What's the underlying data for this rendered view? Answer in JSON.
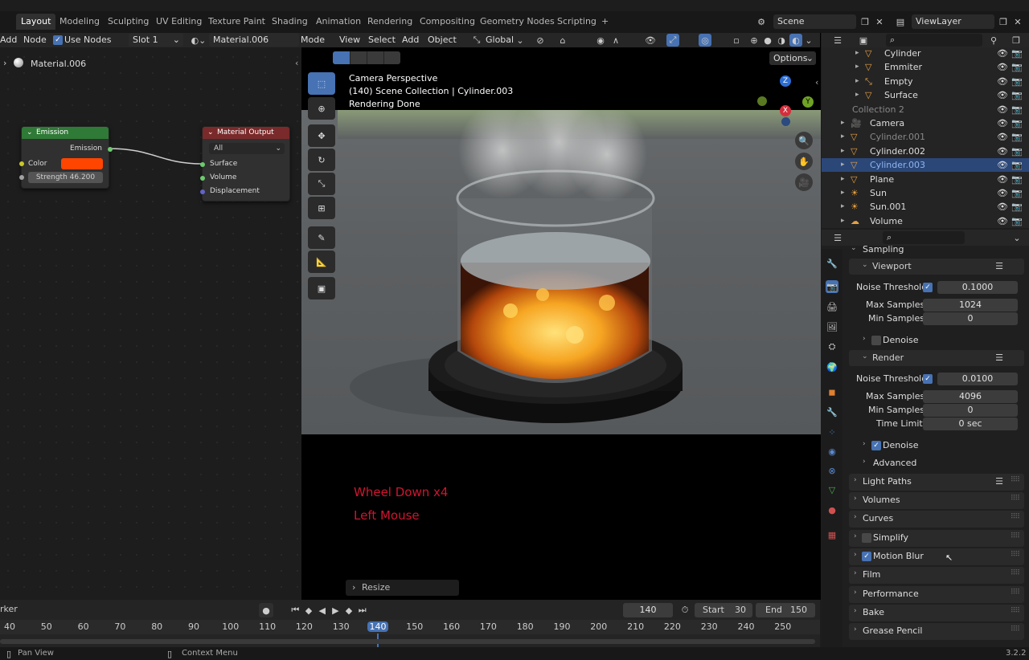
{
  "topbar": {
    "tabs": [
      "Layout",
      "Modeling",
      "Sculpting",
      "UV Editing",
      "Texture Paint",
      "Shading",
      "Animation",
      "Rendering",
      "Compositing",
      "Geometry Nodes",
      "Scripting"
    ],
    "add_tab": "+",
    "scene": "Scene",
    "view_layer": "ViewLayer"
  },
  "node_editor": {
    "menu_add": "Add",
    "menu_node": "Node",
    "use_nodes": "Use Nodes",
    "slot": "Slot 1",
    "material": "Material.006",
    "breadcrumb": "Material.006",
    "emission_node": {
      "title": "Emission",
      "output": "Emission",
      "color_label": "Color",
      "color": "#ff4500",
      "strength": "Strength  46.200"
    },
    "output_node": {
      "title": "Material Output",
      "target": "All",
      "surface": "Surface",
      "volume": "Volume",
      "displacement": "Displacement"
    }
  },
  "viewport": {
    "menu": [
      "Mode",
      "View",
      "Select",
      "Add",
      "Object"
    ],
    "orientation": "Global",
    "options": "Options",
    "overlay_lines": [
      "Camera Perspective",
      "(140) Scene Collection | Cylinder.003",
      "Rendering Done"
    ],
    "screencast": [
      "Wheel Down x4",
      "Left Mouse"
    ],
    "resize_panel": "Resize",
    "gizmo_x": "X",
    "gizmo_y": "Y",
    "gizmo_z": "Z"
  },
  "outliner": {
    "rows": [
      {
        "name": "Cylinder",
        "cls": "partial"
      },
      {
        "name": "Emmiter",
        "cls": ""
      },
      {
        "name": "Empty",
        "cls": ""
      },
      {
        "name": "Surface",
        "cls": ""
      },
      {
        "name": "Collection 2",
        "cls": "dim"
      },
      {
        "name": "Camera",
        "cls": ""
      },
      {
        "name": "Cylinder.001",
        "cls": "dim"
      },
      {
        "name": "Cylinder.002",
        "cls": ""
      },
      {
        "name": "Cylinder.003",
        "cls": "selected"
      },
      {
        "name": "Plane",
        "cls": ""
      },
      {
        "name": "Sun",
        "cls": ""
      },
      {
        "name": "Sun.001",
        "cls": ""
      },
      {
        "name": "Volume",
        "cls": ""
      }
    ]
  },
  "properties": {
    "sampling": "Sampling",
    "viewport": "Viewport",
    "render": "Render",
    "noise_threshold": "Noise Threshold",
    "viewport_noise": "0.1000",
    "max_samples": "Max Samples",
    "viewport_max": "1024",
    "min_samples": "Min Samples",
    "viewport_min": "0",
    "denoise": "Denoise",
    "render_noise": "0.0100",
    "render_max": "4096",
    "render_min": "0",
    "time_limit": "Time Limit",
    "time_limit_value": "0 sec",
    "advanced": "Advanced",
    "panels": [
      "Light Paths",
      "Volumes",
      "Curves",
      "Simplify",
      "Motion Blur",
      "Film",
      "Performance",
      "Bake",
      "Grease Pencil"
    ]
  },
  "timeline": {
    "marker": "rker",
    "current_frame": "140",
    "start_label": "Start",
    "start": "30",
    "end_label": "End",
    "end": "150",
    "ticks": [
      "40",
      "50",
      "60",
      "70",
      "80",
      "90",
      "100",
      "110",
      "120",
      "130",
      "140",
      "150",
      "160",
      "170",
      "180",
      "190",
      "200",
      "210",
      "220",
      "230",
      "240",
      "250"
    ]
  },
  "statusbar": {
    "left": "Pan View",
    "middle": "Context Menu",
    "version": "3.2.2"
  },
  "colors": {
    "accent": "#4772b3",
    "selected_row": "#2b4778",
    "emission_header": "#2f7a36",
    "output_header": "#7a2a2a",
    "screencast_text": "#d01530"
  }
}
